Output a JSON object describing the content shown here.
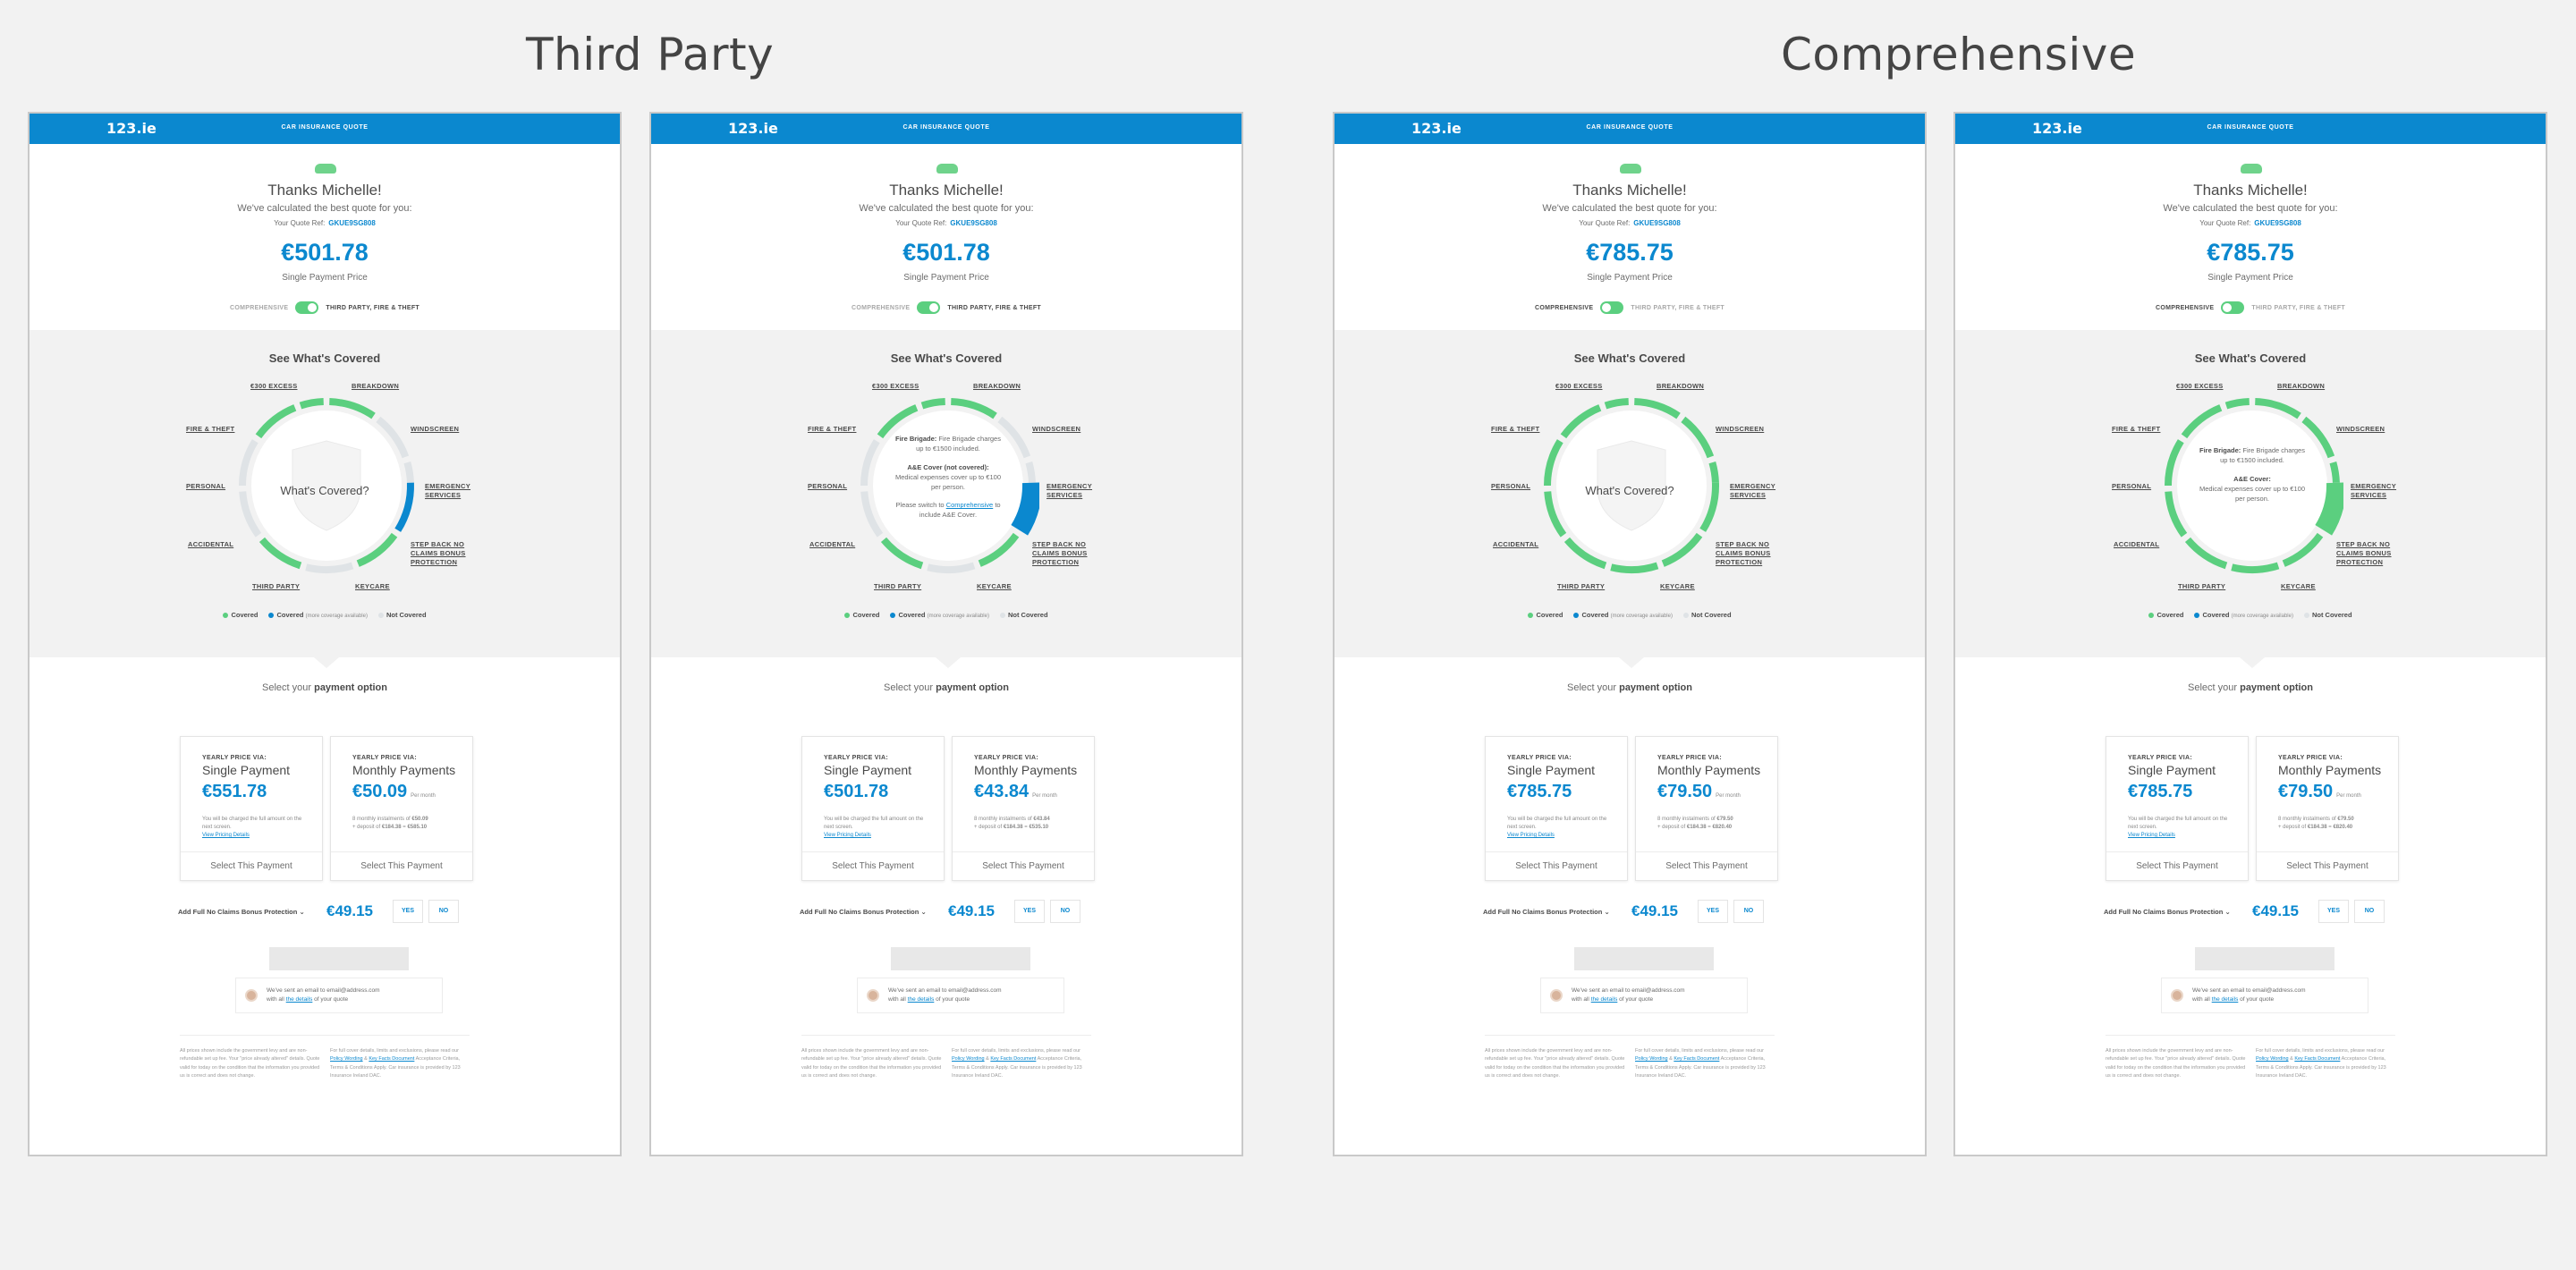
{
  "groups": [
    {
      "title": "Third Party"
    },
    {
      "title": "Comprehensive"
    }
  ],
  "common": {
    "logo": "123.ie",
    "header_title": "CAR INSURANCE QUOTE",
    "thanks": "Thanks Michelle!",
    "calculated": "We've calculated the best quote for you:",
    "quote_ref_label": "Your Quote Ref:",
    "quote_ref": "GKUE9SG808",
    "price_label": "Single Payment Price",
    "toggle_left": "COMPREHENSIVE",
    "toggle_right": "THIRD PARTY, FIRE & THEFT",
    "see_covered": "See What's Covered",
    "center_label": "What's Covered?",
    "labels": {
      "excess": "€300 EXCESS",
      "breakdown": "BREAKDOWN",
      "fire": "FIRE & THEFT",
      "windscreen": "WINDSCREEN",
      "personal": "PERSONAL",
      "emergency": "EMERGENCY SERVICES",
      "accidental": "ACCIDENTAL",
      "stepback": "STEP BACK NO CLAIMS BONUS PROTECTION",
      "thirdparty": "THIRD PARTY",
      "keycare": "KEYCARE"
    },
    "legend_covered": "Covered",
    "legend_more": "Covered",
    "legend_more_note": "(more coverage available)",
    "legend_not": "Not Covered",
    "select_your": "Select your",
    "payment_option": "payment option",
    "yearly_label": "YEARLY PRICE VIA:",
    "single_payment": "Single Payment",
    "monthly_payments": "Monthly Payments",
    "per_month": "Per month",
    "single_note": "You will be charged the full amount on the next screen.",
    "pricing_details": "View Pricing Details",
    "select_payment": "Select This Payment",
    "ncb_label": "Add Full No Claims Bonus Protection",
    "ncb_price": "€49.15",
    "yes": "YES",
    "no": "NO",
    "email_line1": "We've sent an email to email@address.com",
    "email_line2_pre": "with all",
    "email_link": "the details",
    "email_line2_post": "of your quote",
    "foot_left": "All prices shown include the government levy and are non-refundable set up fee. Your \"price already altered\" details. Quote valid for today on the condition that the information you provided us is correct and does not change.",
    "foot_right_pre": "For full cover details, limits and exclusions, please read our",
    "foot_link1": "Policy Wording",
    "foot_amp": "&",
    "foot_link2": "Key Facts Document",
    "foot_right_post": "Acceptance Criteria, Terms & Conditions Apply. Car insurance is provided by 123 Insurance Ireland DAC."
  },
  "cards": [
    {
      "price": "€501.78",
      "toggle": "third",
      "view": "overview",
      "single_price": "€551.78",
      "monthly_price": "€50.09",
      "monthly_note_1": "8 monthly instalments of",
      "monthly_inst": "€50.09",
      "monthly_note_2": "+ deposit of",
      "monthly_deposit": "€184.38",
      "monthly_note_3": "=",
      "monthly_total": "€585.10",
      "emergency": "#0b88cf",
      "segments": [
        "green",
        "green",
        "grey",
        "blue",
        "green",
        "grey",
        "green",
        "grey",
        "green",
        "green"
      ]
    },
    {
      "price": "€501.78",
      "toggle": "third",
      "view": "detail",
      "single_price": "€501.78",
      "monthly_price": "€43.84",
      "monthly_note_1": "8 monthly instalments of",
      "monthly_inst": "€43.84",
      "monthly_note_2": "+ deposit of",
      "monthly_deposit": "€184.38",
      "monthly_note_3": "=",
      "monthly_total": "€535.10",
      "tip_title1": "Fire Brigade:",
      "tip_text1": "Fire Brigade charges up to €1500 included.",
      "tip_title2": "A&E Cover (not covered):",
      "tip_text2": "Medical expenses cover up to €100 per person.",
      "tip_text3_pre": "Please switch to",
      "tip_link": "Comprehensive",
      "tip_text3_post": "to include A&E Cover."
    },
    {
      "price": "€785.75",
      "toggle": "comp",
      "view": "overview",
      "single_price": "€785.75",
      "monthly_price": "€79.50",
      "monthly_note_1": "8 monthly instalments of",
      "monthly_inst": "€79.50",
      "monthly_note_2": "+ deposit of",
      "monthly_deposit": "€184.38",
      "monthly_note_3": "=",
      "monthly_total": "€820.40"
    },
    {
      "price": "€785.75",
      "toggle": "comp",
      "view": "detail",
      "single_price": "€785.75",
      "monthly_price": "€79.50",
      "monthly_note_1": "8 monthly instalments of",
      "monthly_inst": "€79.50",
      "monthly_note_2": "+ deposit of",
      "monthly_deposit": "€184.38",
      "monthly_note_3": "=",
      "monthly_total": "€820.40",
      "tip_title1": "Fire Brigade:",
      "tip_text1": "Fire Brigade charges up to €1500 included.",
      "tip_title2": "A&E Cover:",
      "tip_text2": "Medical expenses cover up to €100 per person."
    }
  ],
  "colors": {
    "brand_blue": "#0b88cf",
    "covered_green": "#5bcf7f",
    "not_covered_grey": "#dfe3e6"
  }
}
